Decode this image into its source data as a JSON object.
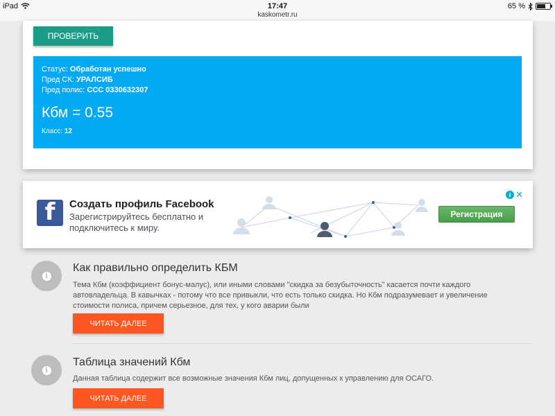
{
  "status_bar": {
    "device": "iPad",
    "time": "17:47",
    "url": "kaskometr.ru",
    "battery": "65 %",
    "battery_level": 0.65
  },
  "check_button": "ПРОВЕРИТЬ",
  "result": {
    "status_label": "Статус:",
    "status_value": "Обработан успешно",
    "prev_ins_label": "Пред СК:",
    "prev_ins_value": "УРАЛСИБ",
    "prev_policy_label": "Пред полис:",
    "prev_policy_value": "ССС 0330632307",
    "kbm": "Кбм = 0.55",
    "class_label": "Класс:",
    "class_value": "12"
  },
  "ad": {
    "logo": "f",
    "title": "Создать профиль Facebook",
    "subtitle": "Зарегистрируйтесь бесплатно и подключитесь к миру.",
    "button": "Регистрация",
    "info": "i",
    "close": "✕"
  },
  "articles": [
    {
      "title": "Как правильно определить КБМ",
      "text": "Тема Кбм (коэффициент бонус-малус), или иными словами \"скидка за безубыточность\" касается почти каждого автовладельца. В кавычках - потому что все привыкли, что есть только скидка. Но Кбм подразумевает и увеличение стоимости полиса, причем серьезное, для тех, у кого аварии были",
      "button": "ЧИТАТЬ ДАЛЕЕ"
    },
    {
      "title": "Таблица значений Кбм",
      "text": "Данная таблица содержит все возможные значения Кбм лиц, допущенных к управлению для ОСАГО.",
      "button": "ЧИТАТЬ ДАЛЕЕ"
    }
  ],
  "icons": {
    "info": "info-icon",
    "wifi": "wifi-icon",
    "bluetooth": "bluetooth-icon",
    "battery": "battery-icon"
  }
}
